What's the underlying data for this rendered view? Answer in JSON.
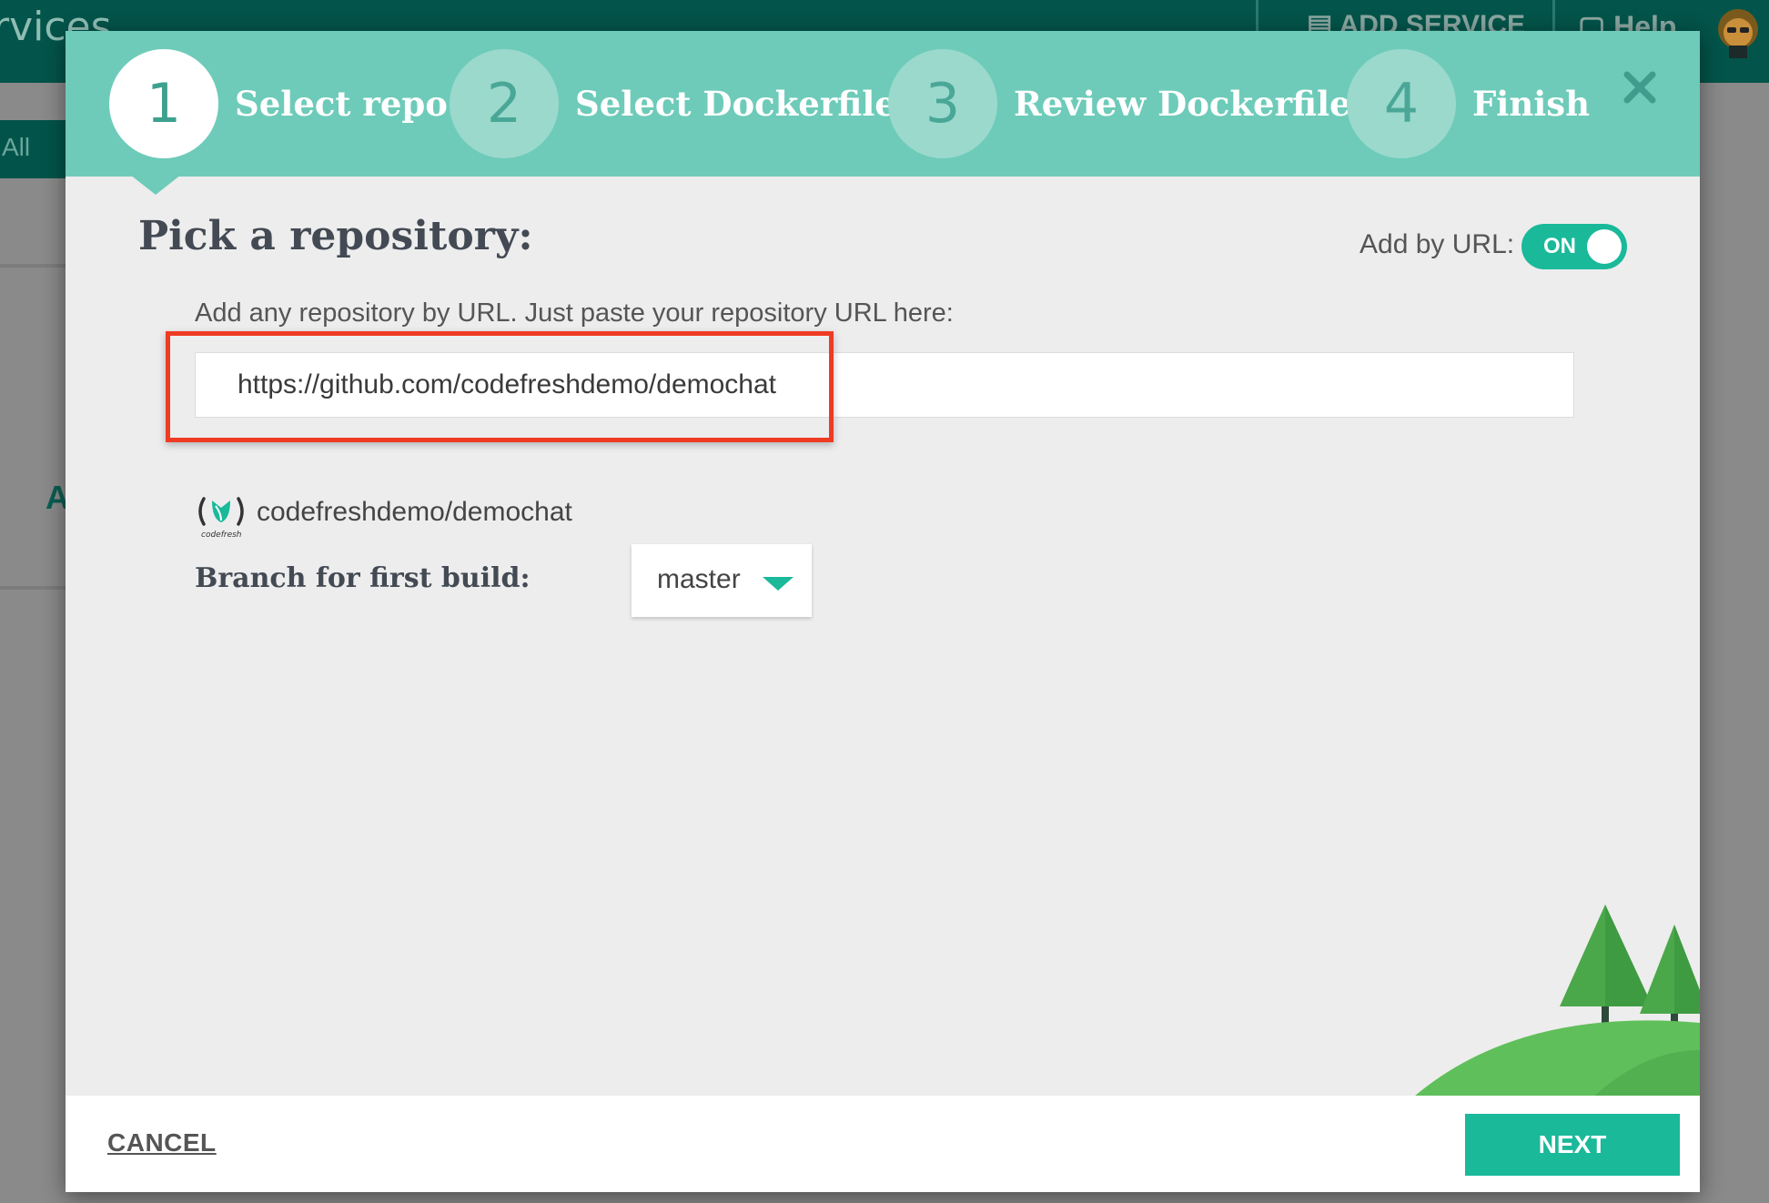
{
  "background": {
    "title_fragment": "rvices",
    "add_service": "ADD SERVICE",
    "help": "Help",
    "filter_all": "All",
    "letter_fragment": "A"
  },
  "wizard": {
    "steps": [
      {
        "number": "1",
        "label": "Select repo",
        "active": true
      },
      {
        "number": "2",
        "label": "Select Dockerfile",
        "active": false
      },
      {
        "number": "3",
        "label": "Review Dockerfile",
        "active": false
      },
      {
        "number": "4",
        "label": "Finish",
        "active": false
      }
    ]
  },
  "content": {
    "title": "Pick a repository:",
    "add_by_url_label": "Add by URL:",
    "toggle_state": "ON",
    "hint": "Add any repository by URL. Just paste your repository URL here:",
    "url_value": "https://github.com/codefreshdemo/demochat",
    "repo_logo_text": "codefresh",
    "repo_name": "codefreshdemo/demochat",
    "branch_label": "Branch for first build:",
    "branch_value": "master"
  },
  "footer": {
    "cancel_label": "CANCEL",
    "next_label": "NEXT"
  },
  "colors": {
    "header": "#6ecbb9",
    "accent": "#19b99a",
    "highlight": "#ef3b24"
  }
}
